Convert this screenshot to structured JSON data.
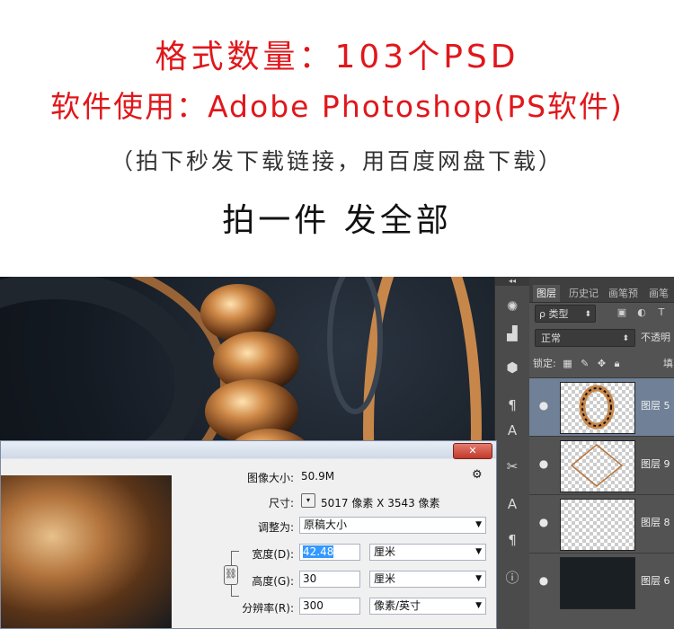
{
  "promo": {
    "line1": "格式数量：103个PSD",
    "line2": "软件使用：Adobe Photoshop(PS软件)",
    "line3": "（拍下秒发下载链接，用百度网盘下载）",
    "line4": "拍一件 发全部"
  },
  "colors": {
    "promo_red": "#e0171b",
    "ps_panel": "#535353",
    "ps_selected": "#6f8097"
  },
  "sidebar": {
    "collapse_glyph": "◂◂",
    "tools": [
      {
        "icon": "brightness-icon",
        "glyph": "✺"
      },
      {
        "icon": "histogram-icon",
        "glyph": "▟"
      },
      {
        "icon": "3d-cube-icon",
        "glyph": "⬢"
      },
      {
        "icon": "paragraph-icon",
        "glyph": "¶"
      },
      {
        "icon": "character-icon",
        "glyph": "A"
      },
      {
        "icon": "tool-presets-icon",
        "glyph": "✂"
      },
      {
        "icon": "character-styles-icon",
        "glyph": "A"
      },
      {
        "icon": "paragraph-styles-icon",
        "glyph": "¶"
      },
      {
        "icon": "info-icon",
        "glyph": "ⓘ"
      }
    ]
  },
  "layers_panel": {
    "tabs": [
      "图层",
      "历史记",
      "画笔预",
      "画笔"
    ],
    "kind_label": "ρ 类型",
    "blend_mode": "正常",
    "opacity_label": "不透明",
    "lock_label": "锁定:",
    "fill_label": "填",
    "filter_icons": [
      "image-filter-icon",
      "adjustment-filter-icon",
      "type-filter-icon"
    ],
    "layers": [
      {
        "name": "图层 5",
        "selected": true
      },
      {
        "name": "图层 9",
        "selected": false
      },
      {
        "name": "图层 8",
        "selected": false
      },
      {
        "name": "图层 6",
        "selected": false
      }
    ]
  },
  "dialog": {
    "close_glyph": "✕",
    "image_size_label": "图像大小:",
    "image_size_value": "50.9M",
    "dimensions_label": "尺寸:",
    "dimensions_value": "5017 像素  X  3543 像素",
    "fit_to_label": "调整为:",
    "fit_to_value": "原稿大小",
    "width_label": "宽度(D):",
    "width_value": "42.48",
    "width_unit": "厘米",
    "height_label": "高度(G):",
    "height_value": "30",
    "height_unit": "厘米",
    "resolution_label": "分辨率(R):",
    "resolution_value": "300",
    "resolution_unit": "像素/英寸"
  }
}
